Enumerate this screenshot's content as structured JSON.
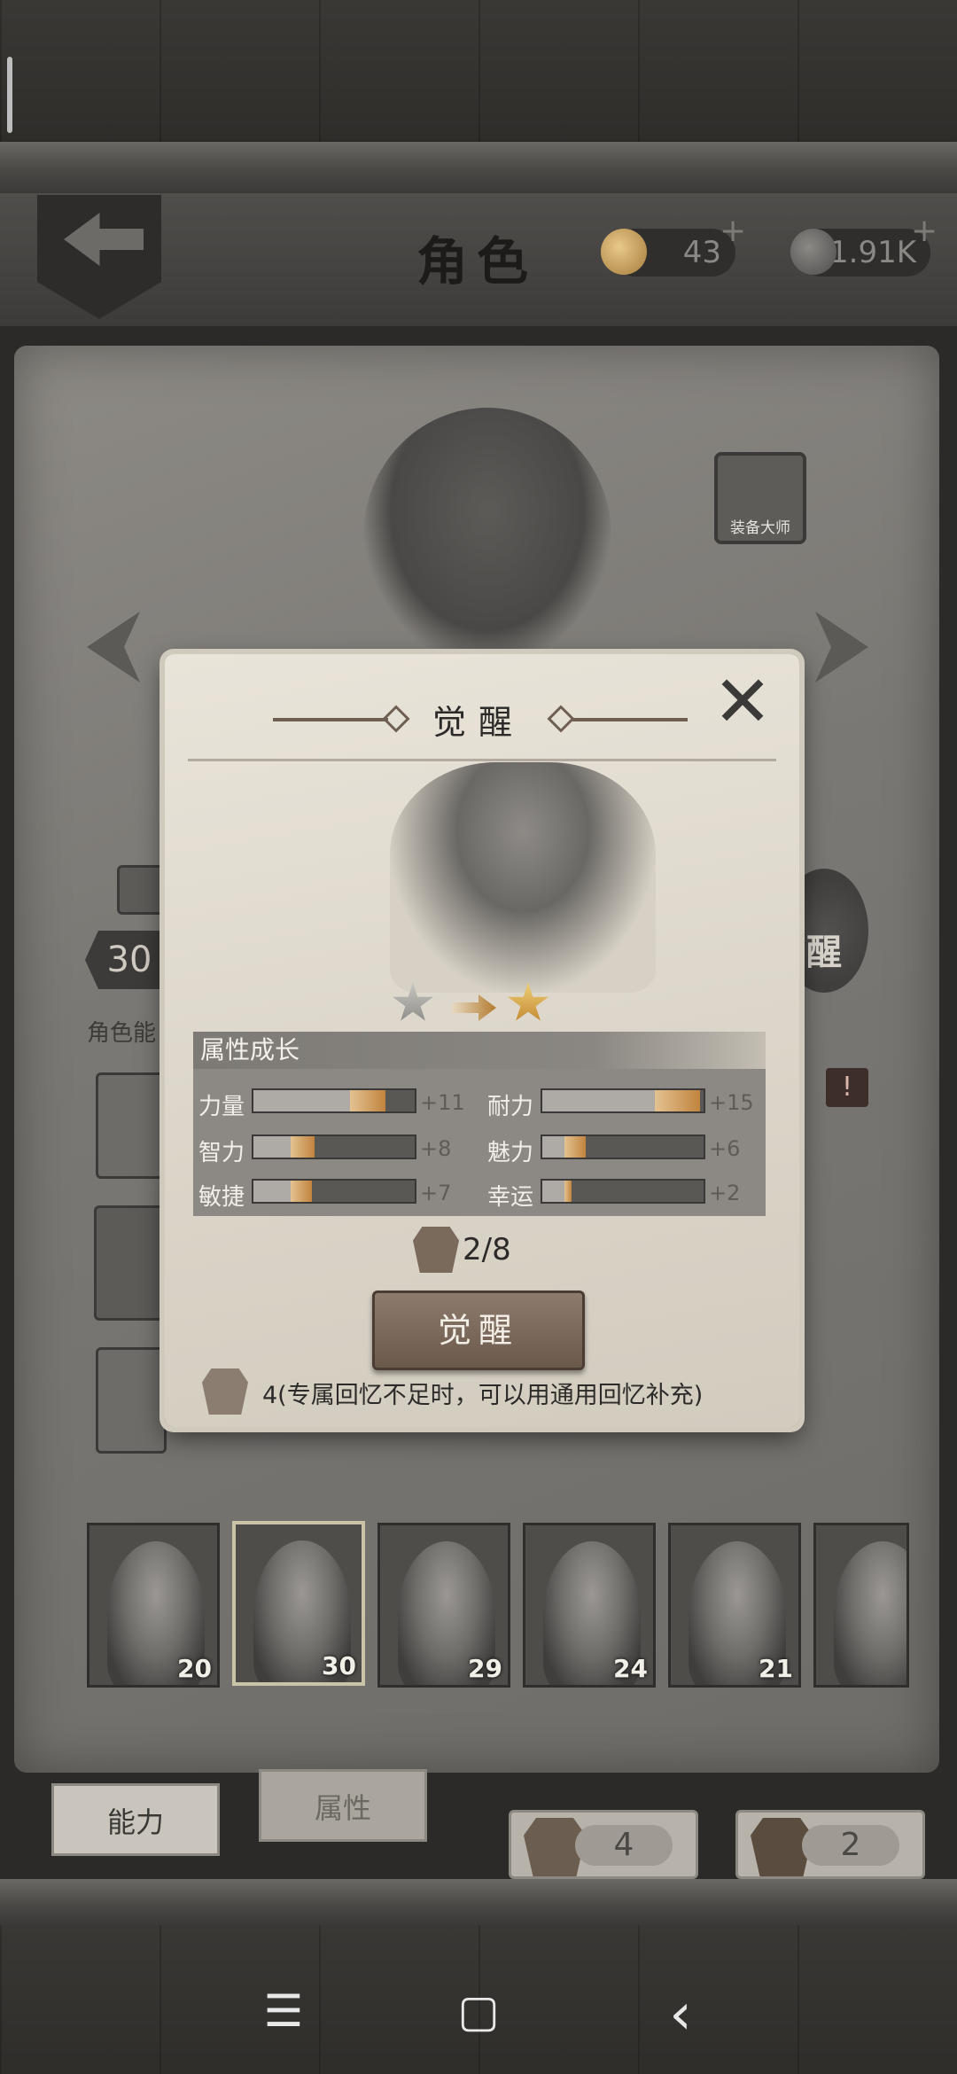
{
  "header": {
    "title": "角色",
    "shells": "43",
    "coins": "1.91K",
    "plus": "+"
  },
  "equip_master_label": "装备大师",
  "left_panel": {
    "level": "30",
    "tab_label": "角色能",
    "awaken_side_label": "醒",
    "alert": "!"
  },
  "dialog": {
    "title": "觉醒",
    "close": "✕",
    "attr_section_title": "属性成长",
    "attributes": [
      {
        "name": "力量",
        "value": "+11",
        "base_fraction": 0.6,
        "gain_fraction": 0.22
      },
      {
        "name": "耐力",
        "value": "+15",
        "base_fraction": 0.7,
        "gain_fraction": 0.28
      },
      {
        "name": "智力",
        "value": "+8",
        "base_fraction": 0.23,
        "gain_fraction": 0.15
      },
      {
        "name": "魅力",
        "value": "+6",
        "base_fraction": 0.14,
        "gain_fraction": 0.13
      },
      {
        "name": "敏捷",
        "value": "+7",
        "base_fraction": 0.23,
        "gain_fraction": 0.13
      },
      {
        "name": "幸运",
        "value": "+2",
        "base_fraction": 0.14,
        "gain_fraction": 0.04
      }
    ],
    "memory_progress": "2/8",
    "awaken_button": "觉醒",
    "note": "4(专属回忆不足时，可以用通用回忆补充)"
  },
  "characters": [
    {
      "level": "20"
    },
    {
      "level": "30",
      "selected": true
    },
    {
      "level": "29"
    },
    {
      "level": "24"
    },
    {
      "level": "21"
    },
    {
      "level": ""
    }
  ],
  "bottom_tabs": {
    "ability": "能力",
    "attribute": "属性"
  },
  "memory_pills": {
    "generic": "4",
    "exclusive": "2"
  },
  "nav": {
    "menu": "☰",
    "home": "▢",
    "back": "‹"
  },
  "colors": {
    "parchment": "#ddd7cb",
    "gain_bar": "#c1843f",
    "star_gold": "#d8a23a",
    "star_silver": "#9a9893"
  }
}
